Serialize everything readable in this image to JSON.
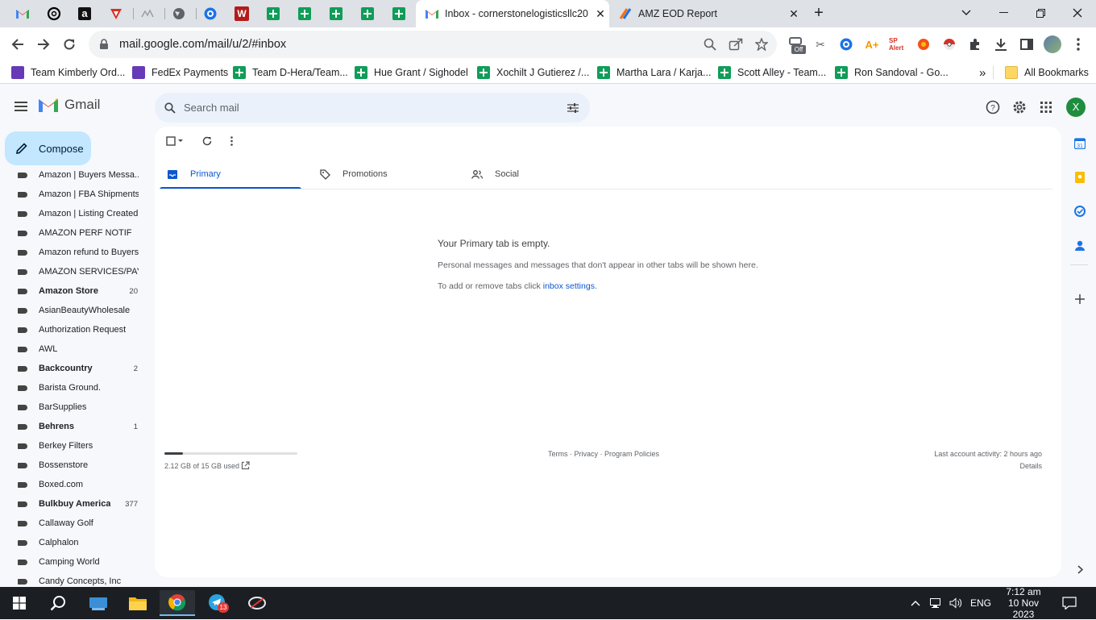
{
  "browser": {
    "pinned_tabs": [
      "gmail-icon",
      "openai-icon",
      "amazon-icon",
      "vpn-icon",
      "generic-icon",
      "globe-icon",
      "extension-icon",
      "w-icon",
      "sheets-icon",
      "sheets-icon",
      "sheets-icon",
      "sheets-icon",
      "sheets-icon"
    ],
    "tabs": [
      {
        "title": "Inbox - cornerstonelogisticsllc20",
        "active": true
      },
      {
        "title": "AMZ EOD Report",
        "active": false
      }
    ],
    "new_tab": "+",
    "url": "mail.google.com/mail/u/2/#inbox",
    "ext_off_badge": "Off",
    "bookmarks": [
      {
        "label": "Team Kimberly Ord...",
        "icon": "forms"
      },
      {
        "label": "FedEx Payments",
        "icon": "forms"
      },
      {
        "label": "Team D-Hera/Team...",
        "icon": "sheets"
      },
      {
        "label": "Hue Grant / Sighodel",
        "icon": "sheets"
      },
      {
        "label": "Xochilt J Gutierez /...",
        "icon": "sheets"
      },
      {
        "label": "Martha Lara / Karja...",
        "icon": "sheets"
      },
      {
        "label": "Scott Alley - Team...",
        "icon": "sheets"
      },
      {
        "label": "Ron Sandoval - Go...",
        "icon": "sheets"
      }
    ],
    "bookmarks_overflow": "»",
    "all_bookmarks": "All Bookmarks"
  },
  "gmail": {
    "logo_text": "Gmail",
    "search_placeholder": "Search mail",
    "avatar_letter": "X",
    "compose_label": "Compose",
    "labels": [
      {
        "name": "Amazon | Buyers Messa...",
        "count": "",
        "bold": false
      },
      {
        "name": "Amazon | FBA Shipments",
        "count": "",
        "bold": false
      },
      {
        "name": "Amazon | Listing Created",
        "count": "",
        "bold": false
      },
      {
        "name": "AMAZON PERF NOTIF",
        "count": "",
        "bold": false
      },
      {
        "name": "Amazon refund to Buyers",
        "count": "",
        "bold": false
      },
      {
        "name": "AMAZON SERVICES/PAY...",
        "count": "",
        "bold": false
      },
      {
        "name": "Amazon Store",
        "count": "20",
        "bold": true
      },
      {
        "name": "AsianBeautyWholesale",
        "count": "",
        "bold": false
      },
      {
        "name": "Authorization Request",
        "count": "",
        "bold": false
      },
      {
        "name": "AWL",
        "count": "",
        "bold": false
      },
      {
        "name": "Backcountry",
        "count": "2",
        "bold": true
      },
      {
        "name": "Barista Ground.",
        "count": "",
        "bold": false
      },
      {
        "name": "BarSupplies",
        "count": "",
        "bold": false
      },
      {
        "name": "Behrens",
        "count": "1",
        "bold": true
      },
      {
        "name": "Berkey Filters",
        "count": "",
        "bold": false
      },
      {
        "name": "Bossenstore",
        "count": "",
        "bold": false
      },
      {
        "name": "Boxed.com",
        "count": "",
        "bold": false
      },
      {
        "name": "Bulkbuy America",
        "count": "377",
        "bold": true
      },
      {
        "name": "Callaway Golf",
        "count": "",
        "bold": false
      },
      {
        "name": "Calphalon",
        "count": "",
        "bold": false
      },
      {
        "name": "Camping World",
        "count": "",
        "bold": false
      },
      {
        "name": "Candy Concepts, Inc",
        "count": "",
        "bold": false
      }
    ],
    "inbox_tabs": [
      {
        "label": "Primary",
        "icon": "inbox-icon"
      },
      {
        "label": "Promotions",
        "icon": "tag-icon"
      },
      {
        "label": "Social",
        "icon": "people-icon"
      }
    ],
    "empty": {
      "heading": "Your Primary tab is empty.",
      "line1": "Personal messages and messages that don't appear in other tabs will be shown here.",
      "line2_prefix": "To add or remove tabs click ",
      "line2_link": "inbox settings",
      "line2_suffix": "."
    },
    "footer": {
      "storage": "2.12 GB of 15 GB used",
      "storage_fraction": 0.14,
      "links": "Terms · Privacy · Program Policies",
      "activity": "Last account activity: 2 hours ago",
      "details": "Details"
    }
  },
  "taskbar": {
    "language": "ENG",
    "time": "7:12 am",
    "date": "10 Nov 2023",
    "telegram_badge": "13"
  }
}
